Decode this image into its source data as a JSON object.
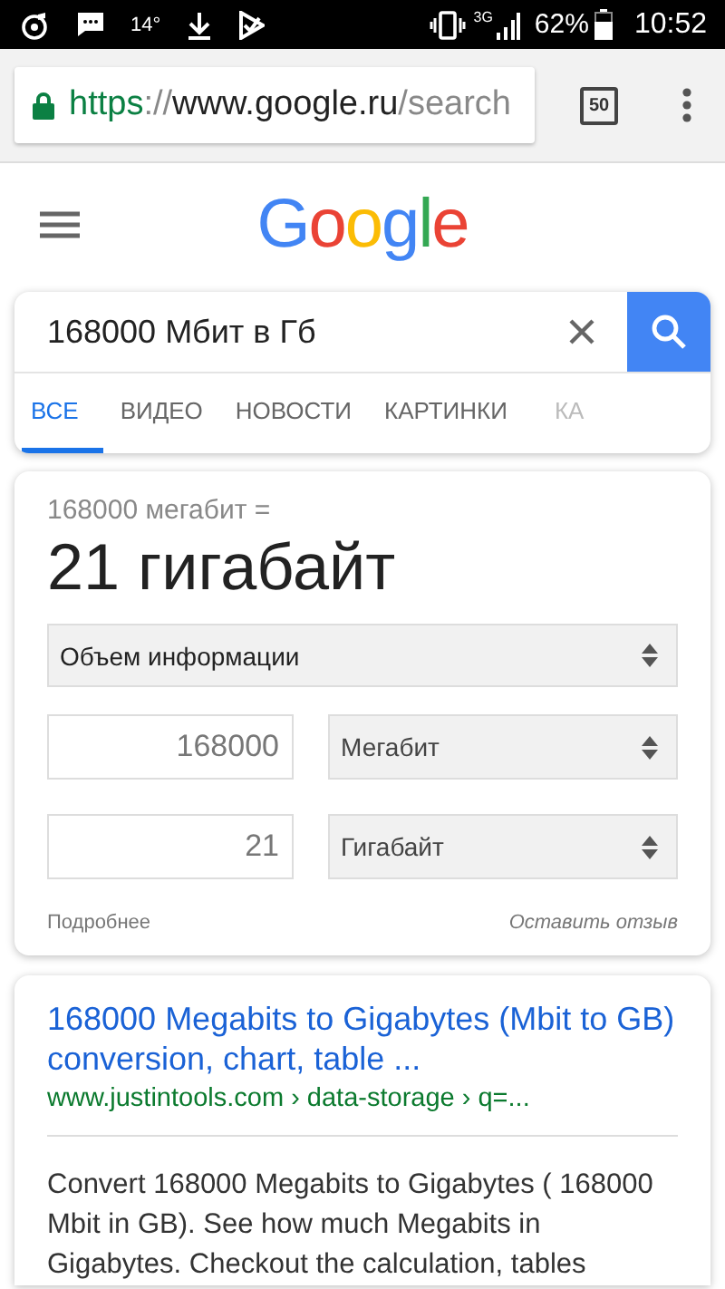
{
  "status_bar": {
    "temperature": "14°",
    "network": "3G",
    "battery": "62%",
    "time": "10:52"
  },
  "browser": {
    "url": [
      {
        "text": "https",
        "kind": "scheme"
      },
      {
        "text": "://",
        "kind": "separator"
      },
      {
        "text": "www.google.ru",
        "kind": "host"
      },
      {
        "text": "/search",
        "kind": "path"
      }
    ],
    "tab_count": "50"
  },
  "header": {
    "logo": "Google"
  },
  "search": {
    "query": "168000 Мбит в Гб",
    "tabs": [
      {
        "label": "ВСЕ",
        "selected": true
      },
      {
        "label": "ВИДЕО",
        "selected": false
      },
      {
        "label": "НОВОСТИ",
        "selected": false
      },
      {
        "label": "КАРТИНКИ",
        "selected": false
      },
      {
        "label": "КА",
        "selected": false
      }
    ]
  },
  "converter": {
    "equation": "168000 мегабит =",
    "result": "21 гигабайт",
    "category": "Объем информации",
    "rows": [
      {
        "value": "168000",
        "unit": "Мегабит"
      },
      {
        "value": "21",
        "unit": "Гигабайт"
      }
    ],
    "more_link": "Подробнее",
    "feedback_link": "Оставить отзыв"
  },
  "result": {
    "title": "168000 Megabits to Gigabytes (Mbit to GB) conversion, chart, table ...",
    "breadcrumb": "www.justintools.com › data-storage › q=...",
    "snippet": "Convert 168000 Megabits to Gigabytes ( 168000 Mbit in GB). See how much Megabits in Gigabytes. Checkout the calculation, tables"
  }
}
